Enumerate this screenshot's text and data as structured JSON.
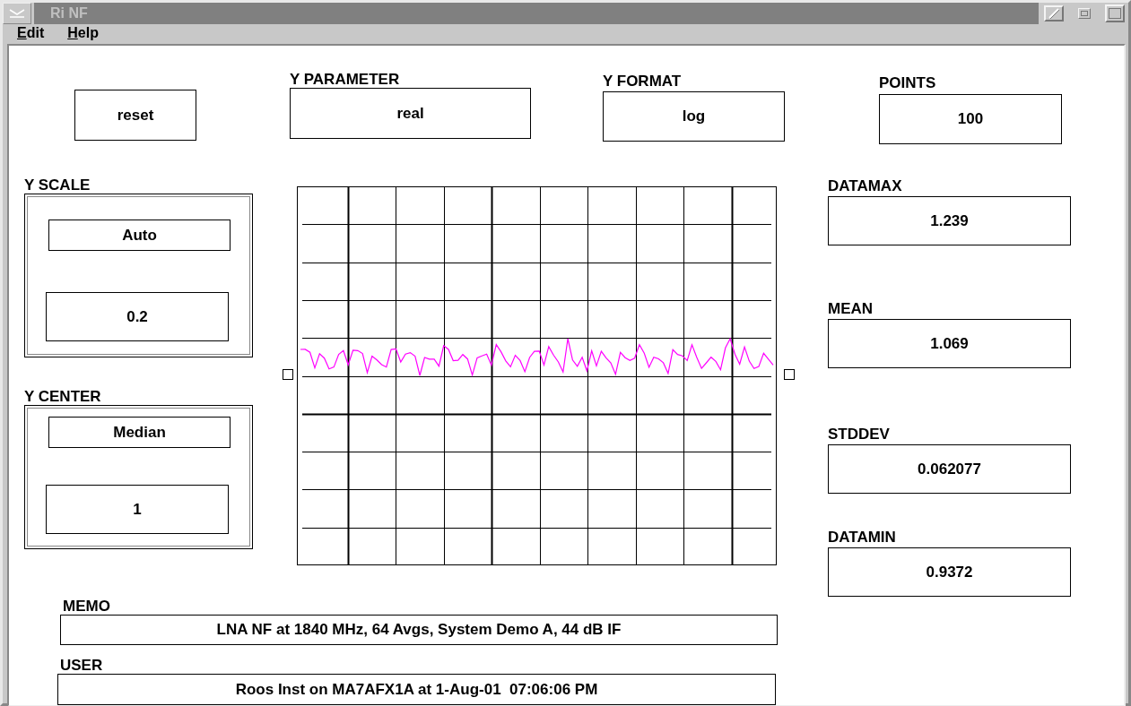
{
  "window": {
    "title": "Ri NF"
  },
  "menu": [
    {
      "label": "Edit"
    },
    {
      "label": "Help"
    }
  ],
  "reset_button": {
    "label": "reset"
  },
  "y_parameter": {
    "label": "Y PARAMETER",
    "value": "real"
  },
  "y_format": {
    "label": "Y FORMAT",
    "value": "log"
  },
  "points": {
    "label": "POINTS",
    "value": "100"
  },
  "y_scale": {
    "label": "Y SCALE",
    "mode": "Auto",
    "value": "0.2"
  },
  "y_center": {
    "label": "Y CENTER",
    "mode": "Median",
    "value": "1"
  },
  "stats": [
    {
      "label": "DATAMAX",
      "value": "1.239"
    },
    {
      "label": "MEAN",
      "value": "1.069"
    },
    {
      "label": "STDDEV",
      "value": "0.062077"
    },
    {
      "label": "DATAMIN",
      "value": "0.9372"
    }
  ],
  "memo": {
    "label": "MEMO",
    "value": "LNA NF at 1840 MHz, 64 Avgs, System Demo A, 44 dB IF"
  },
  "user": {
    "label": "USER",
    "value": "Roos Inst on MA7AFX1A at 1-Aug-01  07:06:06 PM"
  }
}
